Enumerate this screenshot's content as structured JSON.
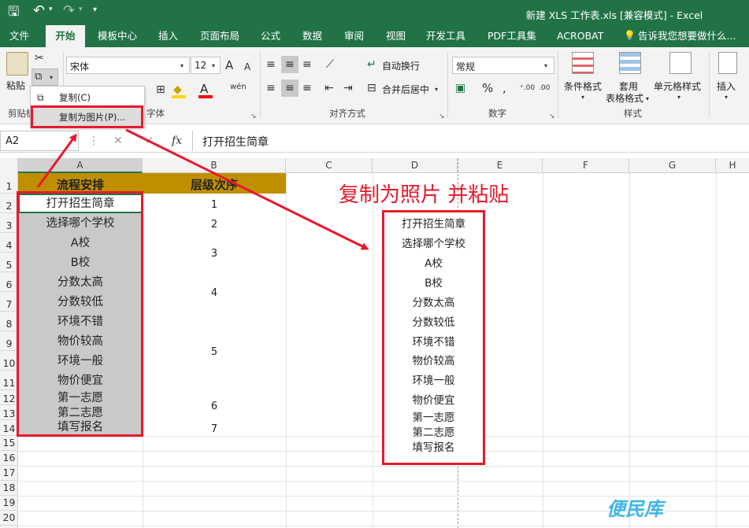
{
  "title_bar": {
    "title": "新建 XLS 工作表.xls  [兼容模式] - Excel",
    "save_icon": "save-icon",
    "undo_icon": "undo-icon",
    "redo_icon": "redo-icon",
    "customize_icon": "customize-quick-access-icon"
  },
  "tabs": [
    {
      "label": "文件"
    },
    {
      "label": "开始"
    },
    {
      "label": "模板中心"
    },
    {
      "label": "插入"
    },
    {
      "label": "页面布局"
    },
    {
      "label": "公式"
    },
    {
      "label": "数据"
    },
    {
      "label": "审阅"
    },
    {
      "label": "视图"
    },
    {
      "label": "开发工具"
    },
    {
      "label": "PDF工具集"
    },
    {
      "label": "ACROBAT"
    },
    {
      "label": "告诉我您想要做什么..."
    }
  ],
  "ribbon": {
    "paste_label": "粘贴",
    "clipboard_group": "剪贴板",
    "font_group": "字体",
    "font_name": "宋体",
    "font_size": "12",
    "alignment_group": "对齐方式",
    "wrap_text": "自动换行",
    "merge_center": "合并后居中",
    "number_group": "数字",
    "number_format": "常规",
    "styles_group": "样式",
    "conditional_format": "条件格式",
    "format_as_table_1": "套用",
    "format_as_table_2": "表格格式",
    "cell_styles": "单元格样式",
    "insert": "插入",
    "increase_font": "A",
    "decrease_font": "A",
    "wen": "wén"
  },
  "copy_menu": {
    "copy": "复制(C)",
    "copy_as_picture": "复制为图片(P)..."
  },
  "formula_bar": {
    "name_box": "A2",
    "formula_value": "打开招生简章",
    "fx": "fx"
  },
  "columns": [
    "A",
    "B",
    "C",
    "D",
    "E",
    "F",
    "G",
    "H"
  ],
  "rows": [
    "1",
    "2",
    "3",
    "4",
    "5",
    "6",
    "7",
    "8",
    "9",
    "10",
    "11",
    "12",
    "13",
    "14",
    "15",
    "16",
    "17",
    "18",
    "19",
    "20"
  ],
  "headers": {
    "col_a": "流程安排",
    "col_b": "层级次序"
  },
  "col_a_values": [
    "打开招生简章",
    "选择哪个学校",
    "A校",
    "B校",
    "分数太高",
    "分数较低",
    "环境不错",
    "物价较高",
    "环境一般",
    "物价便宜",
    "第一志愿",
    "第二志愿",
    "填写报名"
  ],
  "col_b_values": [
    "1",
    "2",
    "3",
    "4",
    "5",
    "6",
    "7"
  ],
  "picture_values": [
    "打开招生简章",
    "选择哪个学校",
    "A校",
    "B校",
    "分数太高",
    "分数较低",
    "环境不错",
    "物价较高",
    "环境一般",
    "物价便宜",
    "第一志愿",
    "第二志愿",
    "填写报名"
  ],
  "annotation": "复制为照片 并粘贴",
  "watermark": "便民库",
  "colors": {
    "excel_green": "#217346",
    "header_gold": "#bf8f00",
    "selection_gray": "#c9c9c9",
    "annotation_red": "#e8192c"
  }
}
